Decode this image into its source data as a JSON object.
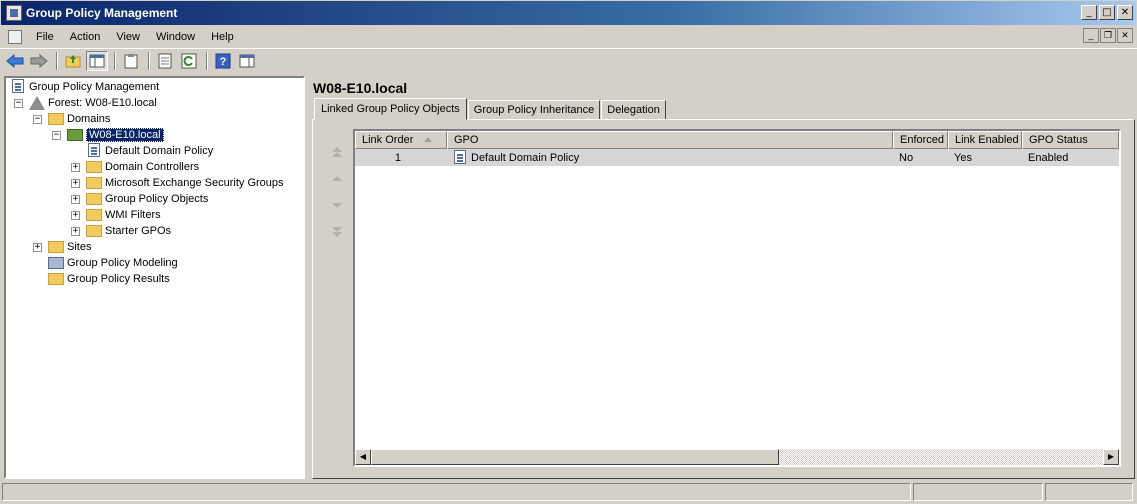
{
  "window": {
    "title": "Group Policy Management"
  },
  "menu": {
    "items": [
      "File",
      "Action",
      "View",
      "Window",
      "Help"
    ]
  },
  "toolbar": {
    "buttons": [
      "back-arrow-icon",
      "forward-arrow-icon",
      "up-folder-icon",
      "show-hide-tree-icon",
      "clipboard-icon",
      "properties-icon",
      "refresh-icon",
      "help-icon",
      "console-icon"
    ]
  },
  "tree": {
    "root": "Group Policy Management",
    "forest": "Forest: W08-E10.local",
    "domains": "Domains",
    "domain": "W08-E10.local",
    "children": [
      "Default Domain Policy",
      "Domain Controllers",
      "Microsoft Exchange Security Groups",
      "Group Policy Objects",
      "WMI Filters",
      "Starter GPOs"
    ],
    "sites": "Sites",
    "modeling": "Group Policy Modeling",
    "results": "Group Policy Results"
  },
  "right": {
    "title": "W08-E10.local",
    "tabs": [
      "Linked Group Policy Objects",
      "Group Policy Inheritance",
      "Delegation"
    ],
    "columns": [
      "Link Order",
      "GPO",
      "Enforced",
      "Link Enabled",
      "GPO Status"
    ],
    "rows": [
      {
        "link_order": "1",
        "gpo": "Default Domain Policy",
        "enforced": "No",
        "link_enabled": "Yes",
        "gpo_status": "Enabled"
      }
    ]
  },
  "colors": {
    "title_bar": "#0a246a",
    "selection": "#0a246a",
    "chrome": "#d4d0c8",
    "row_highlight": "#d6d6d6"
  }
}
